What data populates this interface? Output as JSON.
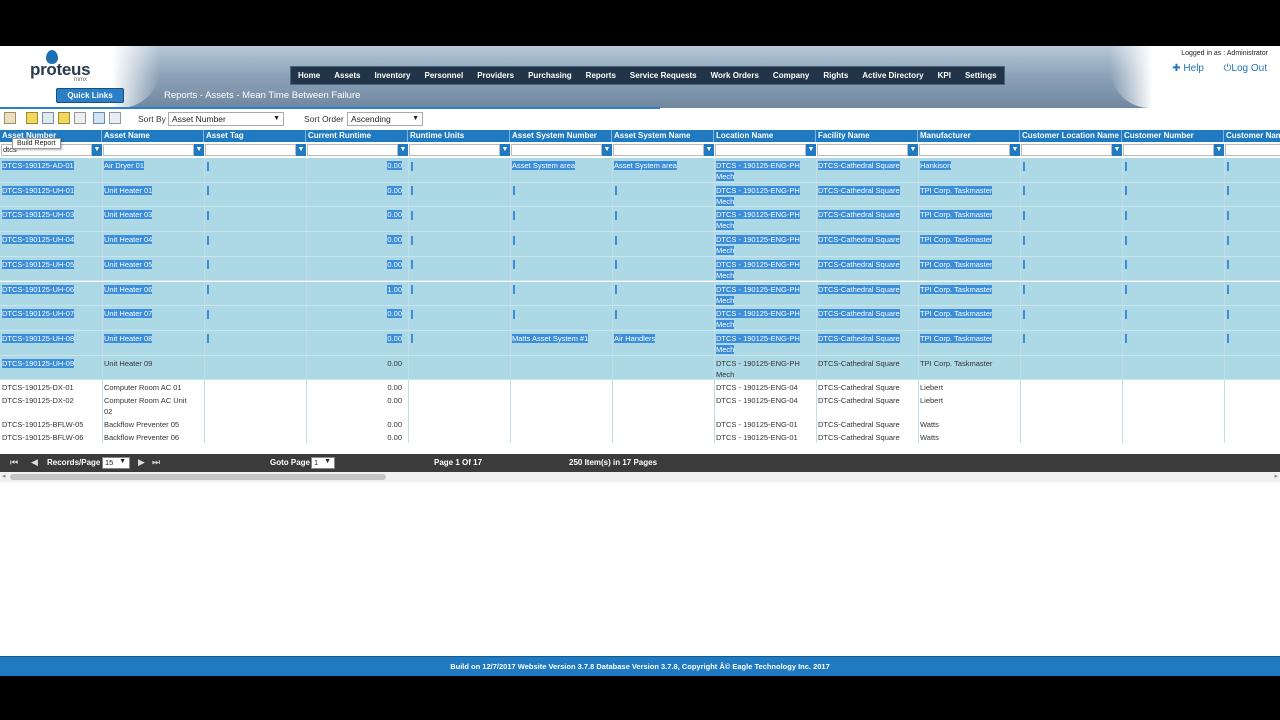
{
  "header": {
    "logo_text": "proteus",
    "logo_sub": "mmx",
    "logged_in": "Logged in as : Administrator",
    "help": "Help",
    "logout": "Log Out",
    "nav": [
      "Home",
      "Assets",
      "Inventory",
      "Personnel",
      "Providers",
      "Purchasing",
      "Reports",
      "Service Requests",
      "Work Orders",
      "Company",
      "Rights",
      "Active Directory",
      "KPI",
      "Settings"
    ]
  },
  "quick_links": "Quick Links",
  "page_title": "Reports - Assets - Mean Time Between Failure",
  "toolbar": {
    "tooltip": "Build Report",
    "sort_by_label": "Sort By",
    "sort_by_value": "Asset Number",
    "sort_order_label": "Sort Order",
    "sort_order_value": "Ascending"
  },
  "grid": {
    "columns": [
      "Asset Number",
      "Asset Name",
      "Asset Tag",
      "Current Runtime",
      "Runtime Units",
      "Asset System Number",
      "Asset System Name",
      "Location Name",
      "Facility Name",
      "Manufacturer",
      "Customer Location Name",
      "Customer Number",
      "Customer Nam"
    ],
    "filter_value": "dtcs",
    "rows": [
      {
        "num": "DTCS-190125-AD-01",
        "name": "Air Dryer 01",
        "runtime": "0.00",
        "sysnum": "Asset System area",
        "sysname": "Asset System area",
        "loc1": "DTCS - 190125-ENG-PH",
        "loc2": "Mech",
        "facility": "DTCS-Cathedral Square",
        "mfr": "Hankison"
      },
      {
        "num": "DTCS-190125-UH-01",
        "name": "Unit Heater 01",
        "runtime": "0.00",
        "sysnum": "",
        "sysname": "",
        "loc1": "DTCS - 190125-ENG-PH",
        "loc2": "Mech",
        "facility": "DTCS-Cathedral Square",
        "mfr": "TPI Corp. Taskmaster"
      },
      {
        "num": "DTCS-190125-UH-03",
        "name": "Unit Heater 03",
        "runtime": "0.00",
        "sysnum": "",
        "sysname": "",
        "loc1": "DTCS - 190125-ENG-PH",
        "loc2": "Mech",
        "facility": "DTCS-Cathedral Square",
        "mfr": "TPI Corp. Taskmaster"
      },
      {
        "num": "DTCS-190125-UH-04",
        "name": "Unit Heater 04",
        "runtime": "0.00",
        "sysnum": "",
        "sysname": "",
        "loc1": "DTCS - 190125-ENG-PH",
        "loc2": "Mech",
        "facility": "DTCS-Cathedral Square",
        "mfr": "TPI Corp. Taskmaster"
      },
      {
        "num": "DTCS-190125-UH-05",
        "name": "Unit Heater 05",
        "runtime": "0.00",
        "sysnum": "",
        "sysname": "",
        "loc1": "DTCS - 190125-ENG-PH",
        "loc2": "Mech",
        "facility": "DTCS-Cathedral Square",
        "mfr": "TPI Corp. Taskmaster"
      },
      {
        "num": "DTCS-190125-UH-06",
        "name": "Unit Heater 06",
        "runtime": "1.00",
        "sysnum": "",
        "sysname": "",
        "loc1": "DTCS - 190125-ENG-PH",
        "loc2": "Mech",
        "facility": "DTCS-Cathedral Square",
        "mfr": "TPI Corp. Taskmaster"
      },
      {
        "num": "DTCS-190125-UH-07",
        "name": "Unit Heater 07",
        "runtime": "0.00",
        "sysnum": "",
        "sysname": "",
        "loc1": "DTCS - 190125-ENG-PH",
        "loc2": "Mech",
        "facility": "DTCS-Cathedral Square",
        "mfr": "TPI Corp. Taskmaster"
      },
      {
        "num": "DTCS-190125-UH-08",
        "name": "Unit Heater 08",
        "runtime": "0.00",
        "sysnum": "Matts Asset System #1",
        "sysname": "Air Handlers",
        "loc1": "DTCS - 190125-ENG-PH",
        "loc2": "Mech",
        "facility": "DTCS-Cathedral Square",
        "mfr": "TPI Corp. Taskmaster"
      },
      {
        "num": "DTCS-190125-UH-09",
        "name": "Unit Heater 09",
        "runtime": "0.00",
        "sysnum": "",
        "sysname": "",
        "loc1": "DTCS - 190125-ENG-PH",
        "loc2": "Mech",
        "facility": "DTCS-Cathedral Square",
        "mfr": "TPI Corp. Taskmaster"
      },
      {
        "num": "DTCS-190125-DX-01",
        "name": "Computer Room AC 01",
        "runtime": "0.00",
        "sysnum": "",
        "sysname": "",
        "loc1": "DTCS - 190125-ENG-04",
        "loc2": "",
        "facility": "DTCS-Cathedral Square",
        "mfr": "Liebert"
      },
      {
        "num": "DTCS-190125-DX-02",
        "name": "Computer Room AC Unit",
        "name2": "02",
        "runtime": "0.00",
        "sysnum": "",
        "sysname": "",
        "loc1": "DTCS - 190125-ENG-04",
        "loc2": "",
        "facility": "DTCS-Cathedral Square",
        "mfr": "Liebert"
      },
      {
        "num": "DTCS-190125-BFLW-05",
        "name": "Backflow Preventer 05",
        "runtime": "0.00",
        "sysnum": "",
        "sysname": "",
        "loc1": "DTCS - 190125-ENG-01",
        "loc2": "",
        "facility": "DTCS-Cathedral Square",
        "mfr": "Watts"
      },
      {
        "num": "DTCS-190125-BFLW-06",
        "name": "Backflow Preventer 06",
        "runtime": "0.00",
        "sysnum": "",
        "sysname": "",
        "loc1": "DTCS - 190125-ENG-01",
        "loc2": "",
        "facility": "DTCS-Cathedral Square",
        "mfr": "Watts"
      }
    ]
  },
  "pager": {
    "first": "⏮",
    "prev": "◀",
    "next": "▶",
    "last": "⏭",
    "records_label": "Records/Page",
    "records_value": "15",
    "goto_label": "Goto Page",
    "goto_value": "1",
    "page_info": "Page 1 Of 17",
    "items_info": "250 Item(s) in 17 Pages"
  },
  "footer": "Build on 12/7/2017 Website Version 3.7.8 Database Version 3.7.8, Copyright Â© Eagle Technology Inc. 2017",
  "colors": {
    "accent": "#1f7ac1",
    "selected_row": "#add8e6",
    "highlight": "#3d8ed8"
  }
}
